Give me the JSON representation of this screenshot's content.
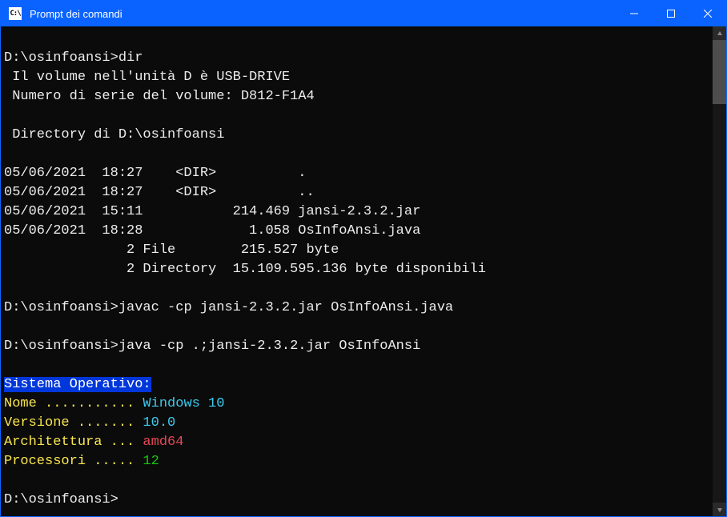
{
  "window": {
    "title": "Prompt dei comandi"
  },
  "term": {
    "prompt1": "D:\\osinfoansi>",
    "cmd1": "dir",
    "vol_line": " Il volume nell'unità D è USB-DRIVE",
    "serial_line": " Numero di serie del volume: D812-F1A4",
    "dir_of": " Directory di D:\\osinfoansi",
    "row1": "05/06/2021  18:27    <DIR>          .",
    "row2": "05/06/2021  18:27    <DIR>          ..",
    "row3": "05/06/2021  15:11           214.469 jansi-2.3.2.jar",
    "row4": "05/06/2021  18:28             1.058 OsInfoAnsi.java",
    "sum1": "               2 File        215.527 byte",
    "sum2": "               2 Directory  15.109.595.136 byte disponibili",
    "prompt2": "D:\\osinfoansi>",
    "cmd2": "javac -cp jansi-2.3.2.jar OsInfoAnsi.java",
    "prompt3": "D:\\osinfoansi>",
    "cmd3": "java -cp .;jansi-2.3.2.jar OsInfoAnsi",
    "header": "Sistema Operativo:",
    "nome_lbl": "Nome ...........",
    "nome_val": " Windows 10",
    "ver_lbl": "Versione .......",
    "ver_val": " 10.0",
    "arch_lbl": "Architettura ...",
    "arch_val": " amd64",
    "proc_lbl": "Processori .....",
    "proc_val": " 12",
    "prompt4": "D:\\osinfoansi>"
  }
}
